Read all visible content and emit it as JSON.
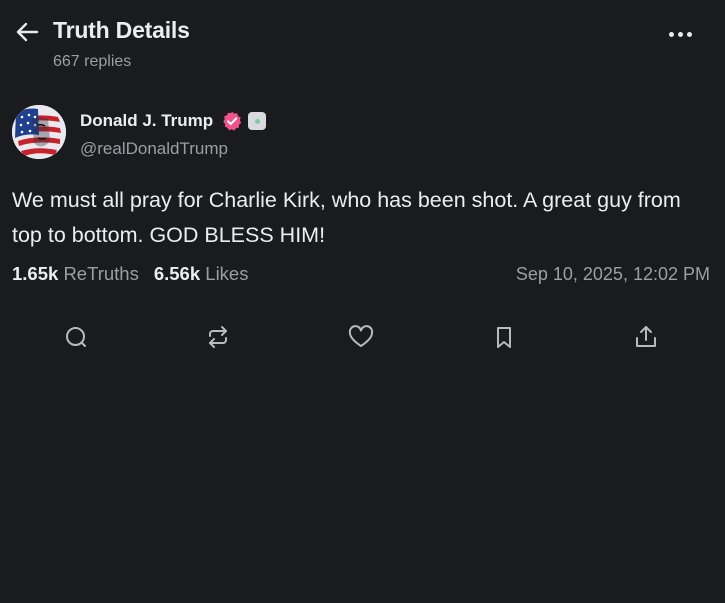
{
  "header": {
    "title": "Truth Details",
    "subtitle": "667 replies"
  },
  "author": {
    "name": "Donald J. Trump",
    "handle": "@realDonaldTrump"
  },
  "post": {
    "text": "We must all pray for Charlie Kirk, who has been shot. A great guy from top to bottom. GOD BLESS HIM!",
    "retruths_count": "1.65k",
    "retruths_label": "ReTruths",
    "likes_count": "6.56k",
    "likes_label": "Likes",
    "timestamp": "Sep 10, 2025, 12:02 PM"
  },
  "actions": [
    {
      "name": "reply",
      "icon": "chat-bubble-icon"
    },
    {
      "name": "retruth",
      "icon": "repost-icon"
    },
    {
      "name": "like",
      "icon": "heart-icon"
    },
    {
      "name": "bookmark",
      "icon": "bookmark-icon"
    },
    {
      "name": "share",
      "icon": "share-icon"
    }
  ],
  "colors": {
    "background": "#1a1b1e",
    "text_primary": "#ecedf0",
    "text_secondary": "#9d9ea3",
    "verified_badge": "#f0528a"
  }
}
